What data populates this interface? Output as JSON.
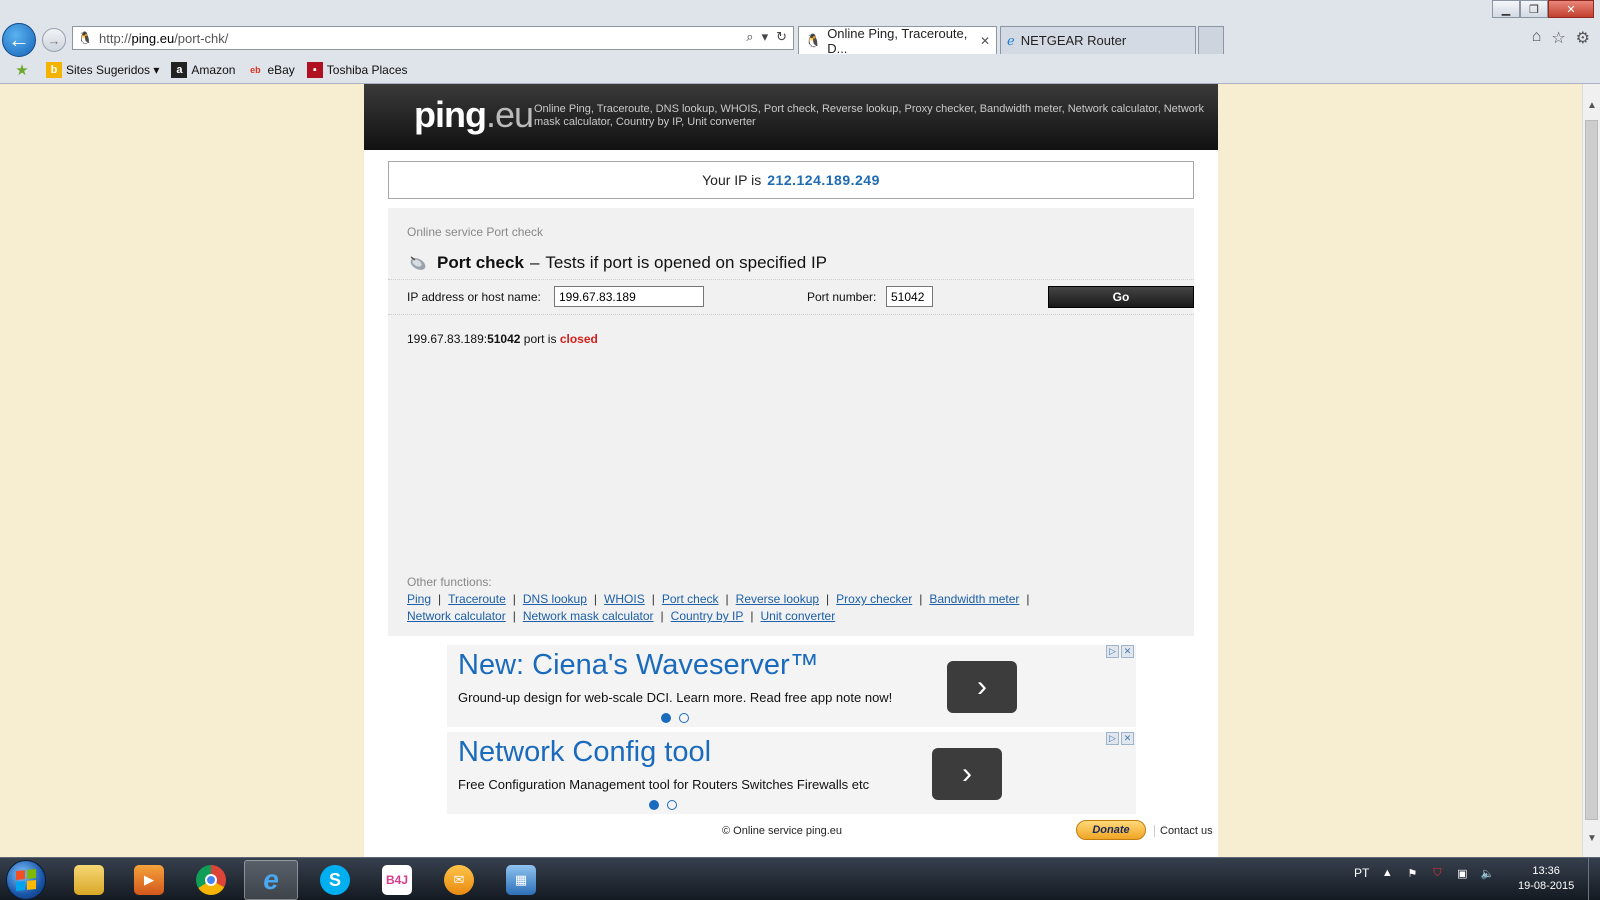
{
  "browser": {
    "url_prefix": "http://",
    "url_domain": "ping.eu",
    "url_path": "/port-chk/",
    "tabs": [
      {
        "label": "Online Ping, Traceroute, D...",
        "active": true
      },
      {
        "label": "NETGEAR Router",
        "active": false
      }
    ],
    "favorites": [
      {
        "label": "Sites Sugeridos ▾"
      },
      {
        "label": "Amazon"
      },
      {
        "label": "eBay"
      },
      {
        "label": "Toshiba Places"
      }
    ]
  },
  "site": {
    "logo_name": "ping",
    "logo_tld": ".eu",
    "tagline": "Online Ping, Traceroute, DNS lookup, WHOIS, Port check, Reverse lookup, Proxy checker, Bandwidth meter, Network calculator, Network mask calculator, Country by IP, Unit converter",
    "your_ip_label": "Your IP is",
    "your_ip": "212.124.189.249",
    "breadcrumb": "Online service Port check",
    "heading_bold": "Port check",
    "heading_dash": "–",
    "heading_rest": "Tests if port is opened on specified IP",
    "ip_label": "IP address or host name:",
    "ip_value": "199.67.83.189",
    "port_label": "Port number:",
    "port_value": "51042",
    "go_label": "Go",
    "result_host": "199.67.83.189:",
    "result_port": "51042",
    "result_mid": " port is ",
    "result_status": "closed",
    "other_title": "Other functions:",
    "links_row1": [
      "Ping",
      "Traceroute",
      "DNS lookup",
      "WHOIS",
      "Port check",
      "Reverse lookup",
      "Proxy checker",
      "Bandwidth meter"
    ],
    "links_row2": [
      "Network calculator",
      "Network mask calculator",
      "Country by IP",
      "Unit converter"
    ],
    "ads": [
      {
        "title": "New: Ciena's Waveserver™",
        "text": "Ground-up design for web-scale DCI. Learn more. Read free app note now!"
      },
      {
        "title": "Network Config tool",
        "text": "Free Configuration Management tool for Routers Switches Firewalls etc"
      }
    ],
    "footer_copy": "© Online service ping.eu",
    "donate_label": "Donate",
    "contact_label": "Contact us"
  },
  "taskbar": {
    "lang": "PT",
    "time": "13:36",
    "date": "19-08-2015",
    "b4j_label": "B4J"
  },
  "colors": {
    "link": "#1d5fa8",
    "ip_highlight": "#1d6bb3",
    "closed": "#d2201e",
    "page_bg": "#f7eed2"
  }
}
